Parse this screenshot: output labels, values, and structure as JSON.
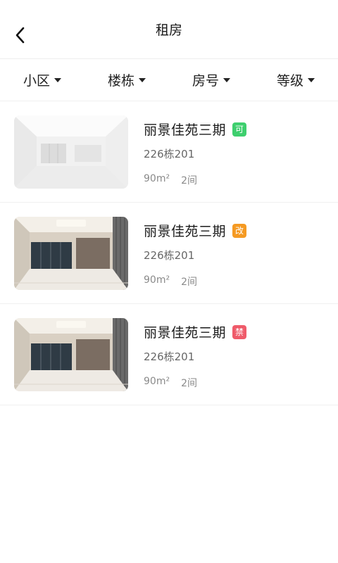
{
  "header": {
    "title": "租房"
  },
  "filters": [
    {
      "label": "小区"
    },
    {
      "label": "楼栋"
    },
    {
      "label": "房号"
    },
    {
      "label": "等级"
    }
  ],
  "listings": [
    {
      "name": "丽景佳苑三期",
      "badge": "可",
      "badge_color": "#3ecf6e",
      "code": "226栋201",
      "area": "90m²",
      "rooms": "2间",
      "image": "bright-empty-room"
    },
    {
      "name": "丽景佳苑三期",
      "badge": "改",
      "badge_color": "#f59a23",
      "code": "226栋201",
      "area": "90m²",
      "rooms": "2间",
      "image": "living-room-interior"
    },
    {
      "name": "丽景佳苑三期",
      "badge": "禁",
      "badge_color": "#ef5b6a",
      "code": "226栋201",
      "area": "90m²",
      "rooms": "2间",
      "image": "living-room-interior"
    }
  ]
}
